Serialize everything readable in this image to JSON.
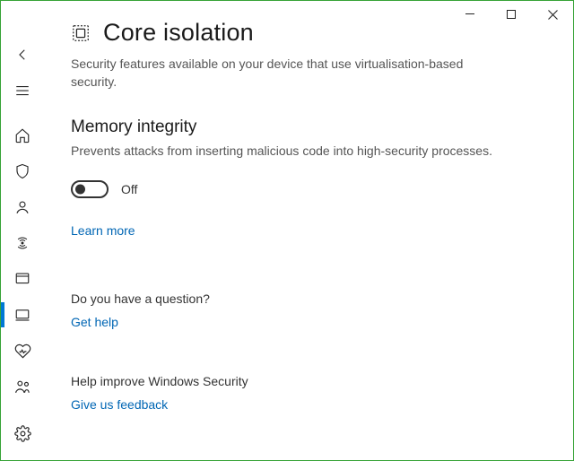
{
  "header": {
    "title": "Core isolation",
    "description": "Security features available on your device that use virtualisation-based security."
  },
  "memory_integrity": {
    "title": "Memory integrity",
    "description": "Prevents attacks from inserting malicious code into high-security processes.",
    "toggle_state": "Off",
    "learn_more": "Learn more"
  },
  "question": {
    "title": "Do you have a question?",
    "link": "Get help"
  },
  "improve": {
    "title": "Help improve Windows Security",
    "link": "Give us feedback"
  },
  "sidebar_icons": {
    "back": "back",
    "menu": "menu",
    "home": "home",
    "shield": "shield",
    "account": "account",
    "firewall": "firewall",
    "app": "app",
    "device": "device",
    "performance": "performance",
    "family": "family",
    "settings": "settings"
  }
}
